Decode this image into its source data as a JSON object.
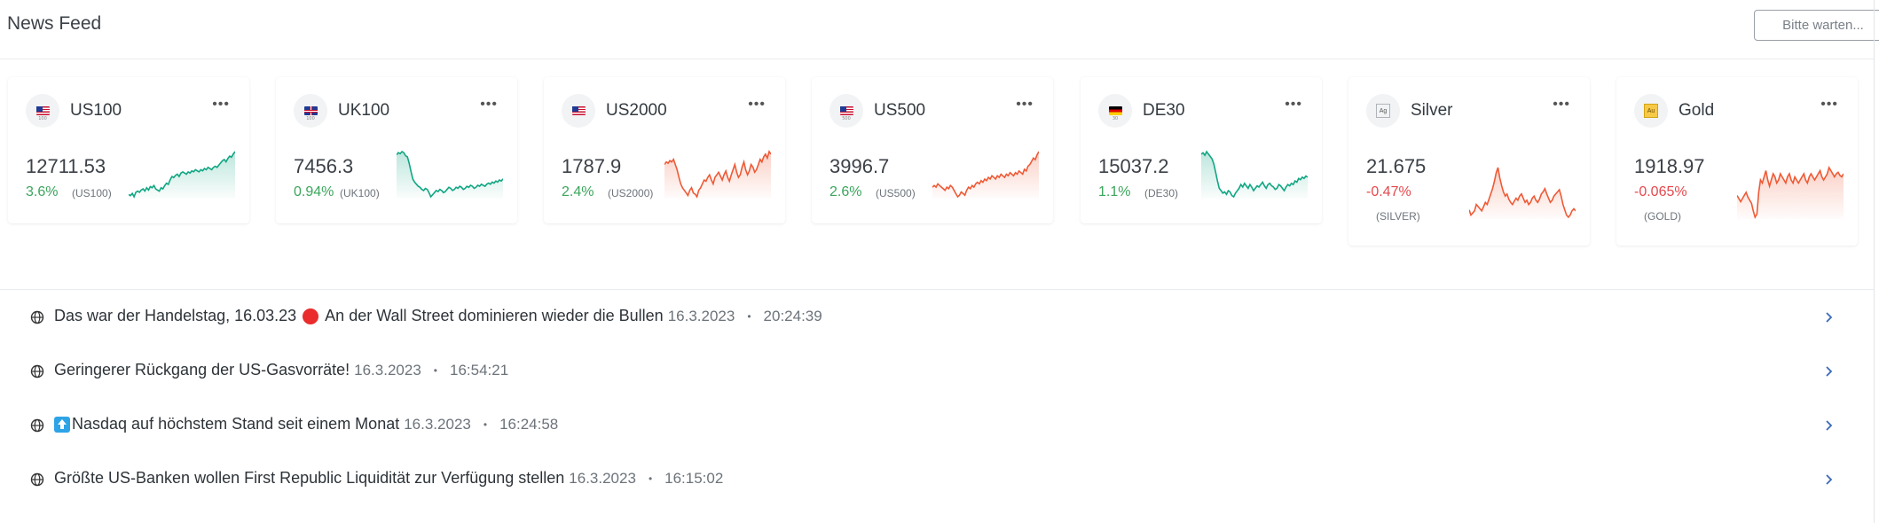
{
  "header": {
    "title": "News Feed",
    "wait_button": "Bitte warten..."
  },
  "colors": {
    "up": "#11a683",
    "down": "#ee5a36",
    "pct_up": "#3ba55c",
    "pct_down": "#e5484d",
    "link_chevron": "#3a6ab8"
  },
  "cards": [
    {
      "symbol": "US100",
      "icon": "us-flag-icon",
      "flag_sub": "100",
      "price": "12711.53",
      "change": "3.6%",
      "code": "(US100)",
      "trend": "up",
      "spark": [
        42,
        41,
        43,
        40,
        44,
        45,
        44,
        46,
        47,
        45,
        48,
        46,
        49,
        48,
        50,
        47,
        46,
        45,
        48,
        47,
        50,
        52,
        51,
        55,
        58,
        57,
        59,
        60,
        58,
        61,
        62,
        61,
        60,
        62,
        61,
        63,
        62,
        64,
        63,
        62,
        64,
        63,
        65,
        64,
        66,
        65,
        64,
        66,
        67,
        66,
        68,
        70,
        72,
        73,
        71,
        74,
        76,
        75,
        78,
        80
      ]
    },
    {
      "symbol": "UK100",
      "icon": "uk-flag-icon",
      "flag_sub": "100",
      "price": "7456.3",
      "change": "0.94%",
      "code": "(UK100)",
      "trend": "up",
      "spark": [
        78,
        80,
        79,
        81,
        80,
        77,
        76,
        70,
        62,
        55,
        52,
        50,
        48,
        47,
        45,
        44,
        46,
        45,
        42,
        38,
        40,
        42,
        44,
        43,
        45,
        44,
        42,
        43,
        45,
        47,
        46,
        44,
        45,
        47,
        46,
        48,
        47,
        45,
        46,
        48,
        47,
        49,
        48,
        46,
        47,
        49,
        48,
        50,
        49,
        48,
        50,
        51,
        50,
        52,
        51,
        53,
        52,
        54,
        53,
        55
      ]
    },
    {
      "symbol": "US2000",
      "icon": "us-flag-icon",
      "flag_sub": "",
      "price": "1787.9",
      "change": "2.4%",
      "code": "(US2000)",
      "trend": "down",
      "spark": [
        70,
        72,
        71,
        73,
        72,
        74,
        70,
        66,
        60,
        55,
        52,
        50,
        48,
        46,
        50,
        52,
        48,
        47,
        45,
        50,
        52,
        55,
        58,
        57,
        60,
        62,
        58,
        55,
        60,
        62,
        64,
        61,
        58,
        62,
        65,
        60,
        57,
        62,
        66,
        70,
        64,
        60,
        62,
        68,
        72,
        66,
        62,
        65,
        70,
        68,
        64,
        66,
        70,
        74,
        72,
        76,
        78,
        75,
        80,
        78
      ]
    },
    {
      "symbol": "US500",
      "icon": "us-flag-icon",
      "flag_sub": "500",
      "price": "3996.7",
      "change": "2.6%",
      "code": "(US500)",
      "trend": "down",
      "spark": [
        52,
        53,
        52,
        54,
        53,
        52,
        51,
        50,
        52,
        51,
        53,
        52,
        50,
        48,
        46,
        47,
        49,
        48,
        47,
        50,
        52,
        51,
        53,
        52,
        54,
        55,
        54,
        56,
        55,
        57,
        56,
        58,
        57,
        59,
        58,
        57,
        59,
        58,
        60,
        59,
        58,
        60,
        59,
        61,
        60,
        59,
        61,
        60,
        62,
        61,
        60,
        63,
        62,
        65,
        66,
        68,
        70,
        69,
        72,
        74
      ]
    },
    {
      "symbol": "DE30",
      "icon": "de-flag-icon",
      "flag_sub": "30",
      "price": "15037.2",
      "change": "1.1%",
      "code": "(DE30)",
      "trend": "up",
      "spark": [
        80,
        81,
        79,
        82,
        80,
        78,
        76,
        72,
        65,
        58,
        52,
        50,
        48,
        49,
        47,
        50,
        49,
        46,
        45,
        48,
        50,
        52,
        55,
        53,
        56,
        54,
        52,
        55,
        53,
        50,
        52,
        54,
        53,
        55,
        57,
        54,
        52,
        55,
        56,
        54,
        53,
        51,
        52,
        55,
        54,
        52,
        50,
        53,
        55,
        54,
        56,
        55,
        58,
        57,
        60,
        59,
        61,
        60,
        62,
        61
      ]
    },
    {
      "symbol": "Silver",
      "icon": "silver-icon",
      "metal_label": "Ag",
      "price": "21.675",
      "change": "-0.47%",
      "code": "(SILVER)",
      "trend": "down",
      "spark": [
        35,
        30,
        32,
        34,
        40,
        38,
        36,
        34,
        38,
        42,
        40,
        45,
        50,
        55,
        62,
        70,
        75,
        65,
        58,
        52,
        48,
        50,
        45,
        42,
        40,
        43,
        46,
        44,
        48,
        50,
        46,
        42,
        44,
        40,
        42,
        46,
        48,
        44,
        42,
        45,
        50,
        52,
        55,
        50,
        46,
        42,
        44,
        48,
        50,
        52,
        54,
        48,
        40,
        35,
        30,
        28,
        30,
        34,
        36,
        34
      ]
    },
    {
      "symbol": "Gold",
      "icon": "gold-icon",
      "metal_label": "Au",
      "price": "1918.97",
      "change": "-0.065%",
      "code": "(GOLD)",
      "trend": "down",
      "spark": [
        50,
        48,
        46,
        48,
        50,
        52,
        49,
        47,
        45,
        40,
        36,
        38,
        52,
        60,
        58,
        62,
        66,
        60,
        56,
        60,
        64,
        62,
        58,
        60,
        64,
        62,
        60,
        58,
        62,
        64,
        60,
        58,
        62,
        60,
        58,
        60,
        62,
        64,
        60,
        58,
        62,
        64,
        62,
        60,
        62,
        64,
        66,
        62,
        60,
        62,
        64,
        68,
        66,
        64,
        62,
        64,
        65,
        63,
        62,
        64
      ]
    }
  ],
  "news": [
    {
      "parts": [
        "Das war der Handelstag, 16.03.23",
        "An der Wall Street dominieren wieder die Bullen"
      ],
      "marker": "red-circle",
      "date": "16.3.2023",
      "time": "20:24:39"
    },
    {
      "parts": [
        "Geringerer Rückgang der US-Gasvorräte!"
      ],
      "marker": "",
      "date": "16.3.2023",
      "time": "16:54:21"
    },
    {
      "parts": [
        "Nasdaq auf höchstem Stand seit einem Monat"
      ],
      "marker": "up-arrow-emoji",
      "date": "16.3.2023",
      "time": "16:24:58"
    },
    {
      "parts": [
        "Größte US-Banken wollen First Republic Liquidität zur Verfügung stellen"
      ],
      "marker": "",
      "date": "16.3.2023",
      "time": "16:15:02"
    }
  ],
  "separator": "•"
}
